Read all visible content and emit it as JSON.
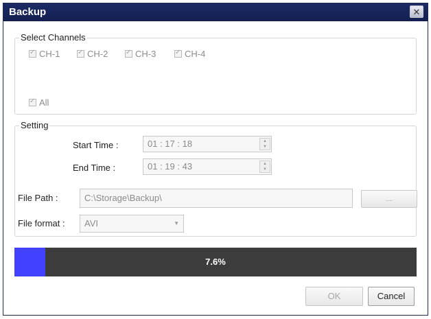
{
  "window": {
    "title": "Backup",
    "close_icon": "close-icon"
  },
  "channels": {
    "legend": "Select Channels",
    "items": [
      {
        "label": "CH-1",
        "checked": true
      },
      {
        "label": "CH-2",
        "checked": true
      },
      {
        "label": "CH-3",
        "checked": true
      },
      {
        "label": "CH-4",
        "checked": true
      }
    ],
    "all_label": "All",
    "all_checked": true
  },
  "setting": {
    "legend": "Setting",
    "start_label": "Start Time :",
    "start_value": "01 : 17 : 18",
    "end_label": "End Time :",
    "end_value": "01 : 19 : 43",
    "path_label": "File Path :",
    "path_value": "C:\\Storage\\Backup\\",
    "browse_label": "....",
    "format_label": "File format :",
    "format_value": "AVI"
  },
  "progress": {
    "text": "7.6%",
    "fraction": 0.076,
    "fill_color": "#4141ff",
    "track_color": "#3c3c3c"
  },
  "buttons": {
    "ok": "OK",
    "cancel": "Cancel"
  }
}
